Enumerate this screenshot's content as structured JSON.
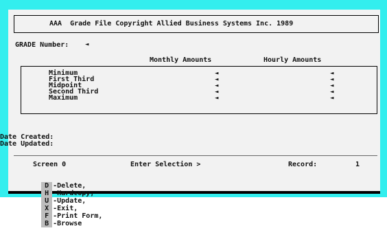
{
  "title": "AAA  Grade File Copyright Allied Business Systems Inc. 1989",
  "grade_label": "GRADE Number:",
  "arrow": "◄",
  "columns": {
    "monthly": "Monthly Amounts",
    "hourly": "Hourly Amounts"
  },
  "rows": [
    "Minimum",
    "First Third",
    "Midpoint",
    "Second Third",
    "Maximum"
  ],
  "dates": {
    "created_label": "Date Created:",
    "updated_label": "Date Updated:"
  },
  "status": {
    "screen": "Screen 0",
    "prompt": "Enter Selection >",
    "record_label": "Record:",
    "record_value": "1"
  },
  "commands": [
    {
      "key": "D",
      "label": "-Delete,"
    },
    {
      "key": "H",
      "label": "-Hardcopy,"
    },
    {
      "key": "U",
      "label": "-Update,"
    },
    {
      "key": "X",
      "label": "-Exit,"
    },
    {
      "key": "F",
      "label": "-Print Form,"
    },
    {
      "key": "B",
      "label": "-Browse"
    }
  ],
  "colors": {
    "frame": "#33eeee",
    "screen": "#f2f2f2",
    "key_bg": "#bdbdbd"
  }
}
